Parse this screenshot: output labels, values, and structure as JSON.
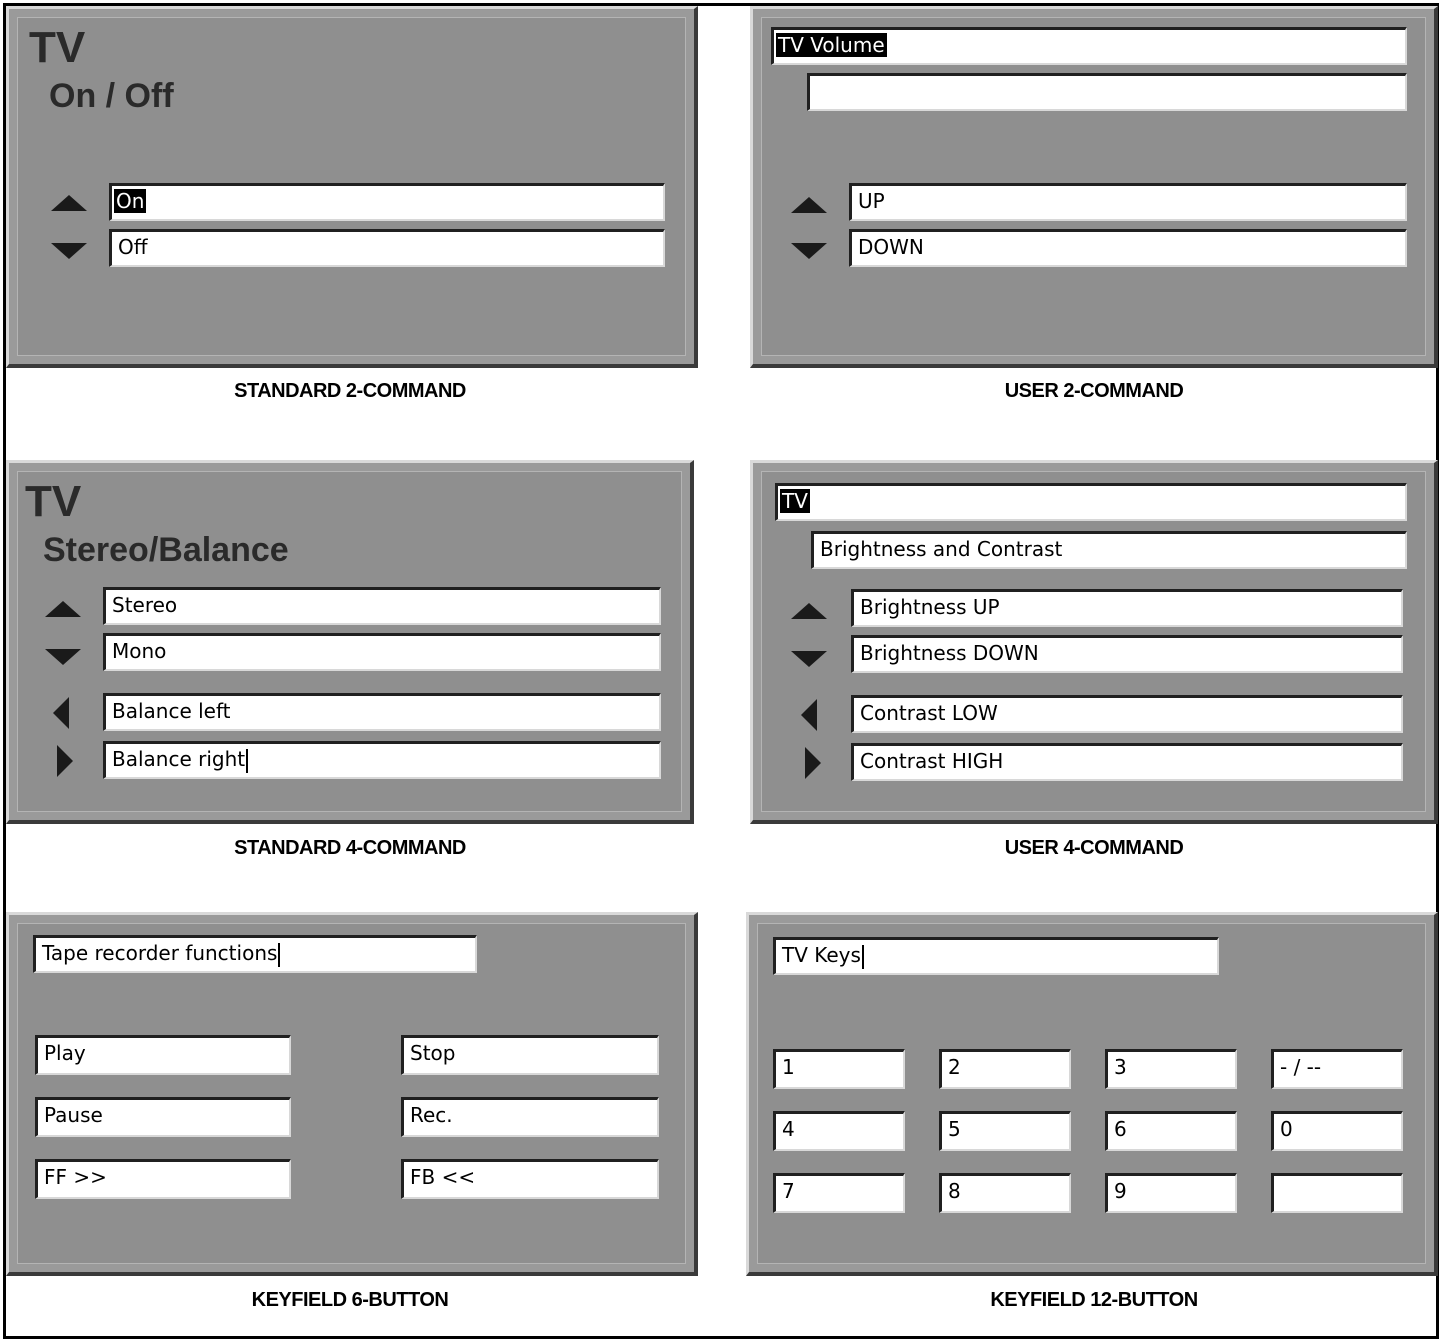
{
  "panels": {
    "std2": {
      "title": "TV",
      "subtitle": "On / Off",
      "commands": [
        "On",
        "Off"
      ],
      "caption": "STANDARD 2-COMMAND"
    },
    "user2": {
      "title_field": "TV Volume",
      "subtitle_field": "",
      "commands": [
        "UP",
        "DOWN"
      ],
      "caption": "USER 2-COMMAND"
    },
    "std4": {
      "title": "TV",
      "subtitle": "Stereo/Balance",
      "commands": [
        "Stereo",
        "Mono",
        "Balance left",
        "Balance right"
      ],
      "caption": "STANDARD 4-COMMAND"
    },
    "user4": {
      "title_field": "TV",
      "subtitle_field": "Brightness and Contrast",
      "commands": [
        "Brightness UP",
        "Brightness DOWN",
        "Contrast LOW",
        "Contrast HIGH"
      ],
      "caption": "USER 4-COMMAND"
    },
    "key6": {
      "title_field": "Tape recorder functions",
      "buttons": [
        "Play",
        "Stop",
        "Pause",
        "Rec.",
        "FF >>",
        "FB <<"
      ],
      "caption": "KEYFIELD 6-BUTTON"
    },
    "key12": {
      "title_field": "TV Keys",
      "buttons": [
        "1",
        "2",
        "3",
        "- / --",
        "4",
        "5",
        "6",
        "0",
        "7",
        "8",
        "9",
        ""
      ],
      "caption": "KEYFIELD 12-BUTTON"
    }
  }
}
